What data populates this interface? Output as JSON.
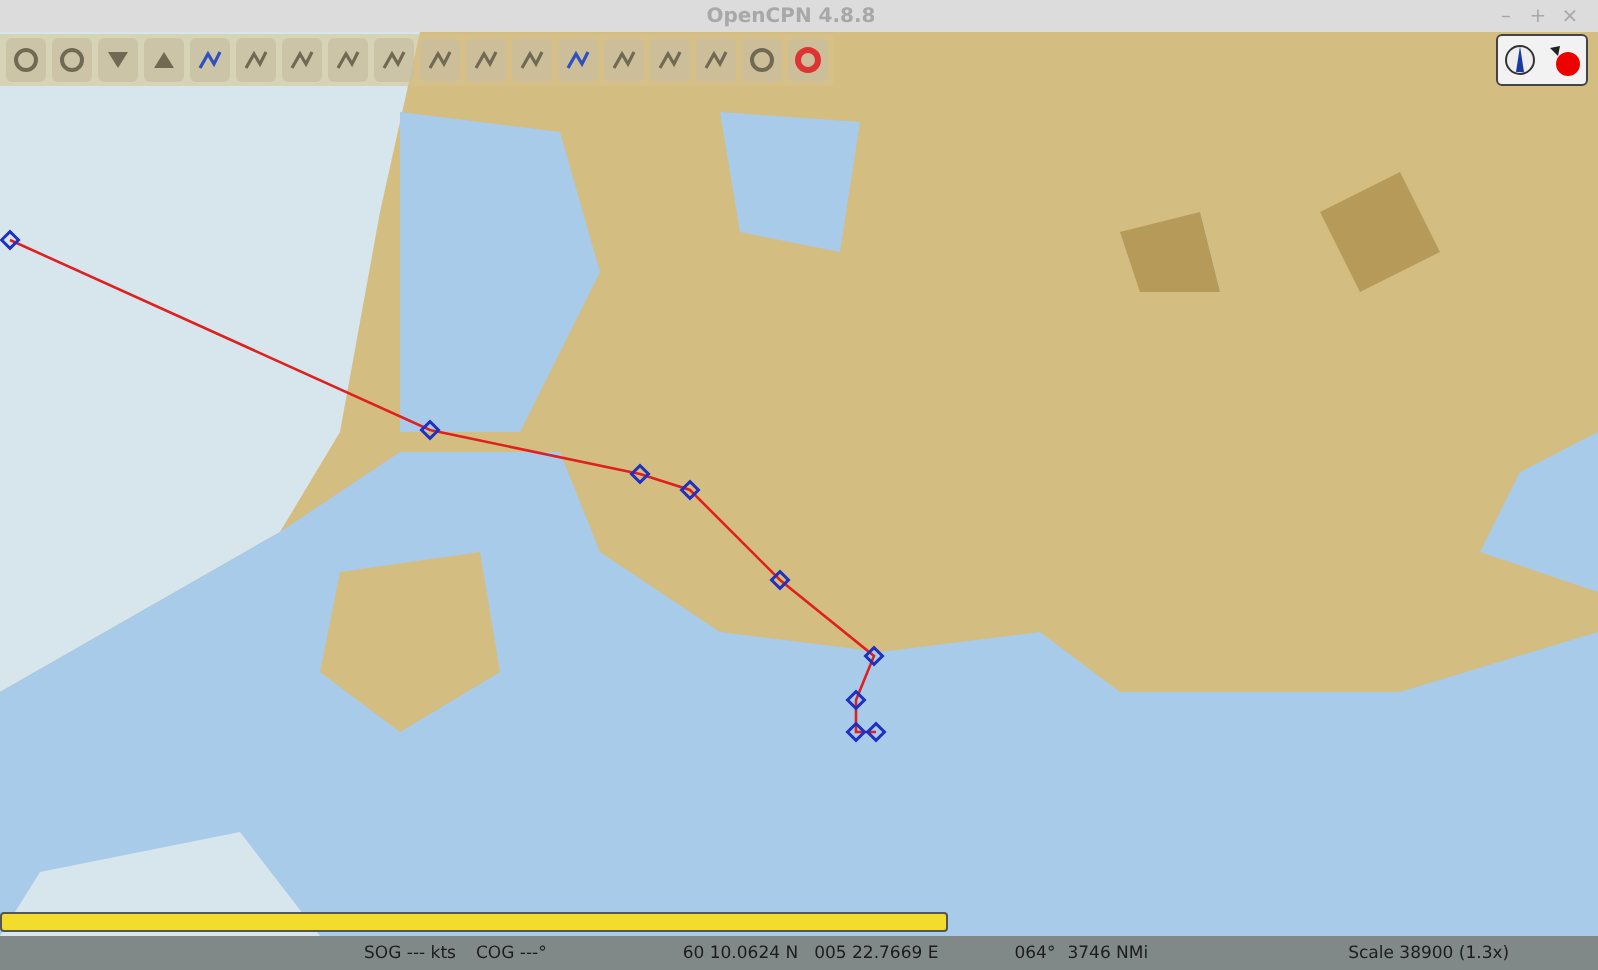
{
  "window": {
    "title": "OpenCPN 4.8.8",
    "controls": [
      "–",
      "+",
      "×"
    ]
  },
  "status_bar": {
    "sog": "SOG --- kts",
    "cog": "COG ---°",
    "latitude": "60 10.0624 N",
    "longitude": "005 22.7669 E",
    "bearing": "064°",
    "distance": "3746 NMi",
    "scale": "Scale 38900 (1.3x)"
  }
}
